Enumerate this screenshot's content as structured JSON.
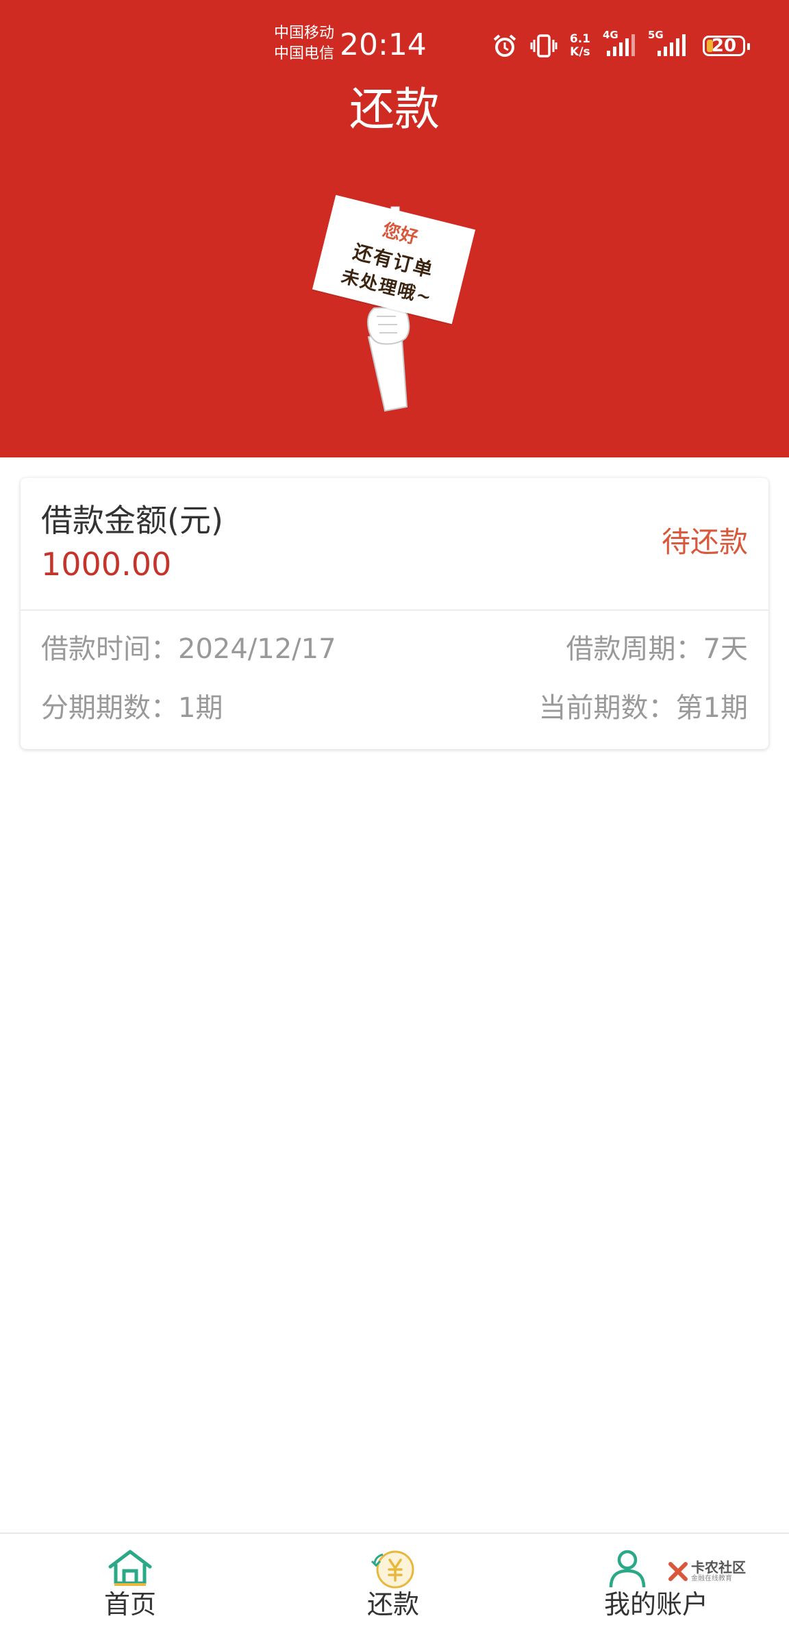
{
  "status_bar": {
    "carrier_1": "中国移动",
    "carrier_2": "中国电信",
    "time": "20:14",
    "net_speed_value": "6.1",
    "net_speed_unit": "K/s",
    "signal_1_label": "4G",
    "signal_2_label": "5G",
    "battery": "20"
  },
  "header": {
    "title": "还款",
    "sign_line_1": "您好",
    "sign_line_2": "还有订单",
    "sign_line_3": "未处理哦~"
  },
  "loan_card": {
    "amount_label": "借款金额(元)",
    "amount_value": "1000.00",
    "status": "待还款",
    "loan_time_label": "借款时间：",
    "loan_time_value": "2024/12/17",
    "loan_period_label": "借款周期：",
    "loan_period_value": "7天",
    "installments_label": "分期期数：",
    "installments_value": "1期",
    "current_period_label": "当前期数：",
    "current_period_value": "第1期"
  },
  "tabbar": {
    "home_label": "首页",
    "repay_label": "还款",
    "account_label": "我的账户"
  },
  "watermark": {
    "line_1": "卡农社区",
    "line_2": "金融在线教育"
  },
  "colors": {
    "header_bg": "#cf2b22",
    "amount": "#c5332a",
    "status": "#d9573a",
    "tab_icon_green": "#2aa887",
    "tab_icon_gold": "#e9b73c"
  }
}
